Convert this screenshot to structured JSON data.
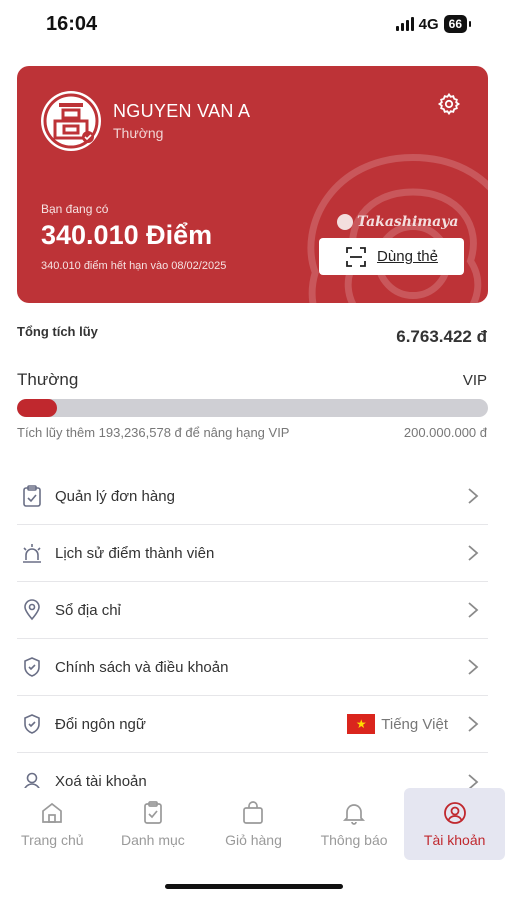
{
  "status_bar": {
    "time": "16:04",
    "network": "4G",
    "battery": "66"
  },
  "card": {
    "user_name": "NGUYEN VAN A",
    "tier": "Thường",
    "points_label": "Bạn đang có",
    "points_value": "340.010 Điểm",
    "points_expiry": "340.010 điểm hết hạn vào 08/02/2025",
    "brand": "Takashimaya",
    "use_card_label": "Dùng thẻ",
    "icons": {
      "avatar": "takashimaya-logo-icon",
      "settings": "gear-icon",
      "scan": "scan-frame-icon"
    },
    "color": "#bd3337"
  },
  "summary": {
    "total_label": "Tổng tích lũy",
    "total_value": "6.763.422 đ",
    "tier_current": "Thường",
    "tier_next": "VIP",
    "progress_fraction": 0.085,
    "progress_note": "Tích lũy thêm 193,236,578 đ để nâng hạng VIP",
    "progress_target": "200.000.000 đ",
    "accent_color": "#c0282e"
  },
  "menu": [
    {
      "label": "Quản lý đơn hàng",
      "icon": "clipboard-check-icon"
    },
    {
      "label": "Lịch sử điểm thành viên",
      "icon": "siren-icon"
    },
    {
      "label": "Sổ địa chỉ",
      "icon": "location-pin-icon"
    },
    {
      "label": "Chính sách và điều khoản",
      "icon": "shield-check-icon"
    },
    {
      "label": "Đổi ngôn ngữ",
      "icon": "shield-check-icon",
      "value": "Tiếng Việt",
      "value_icon": "vietnam-flag-icon"
    },
    {
      "label": "Xoá tài khoản",
      "icon": "user-icon"
    }
  ],
  "tabbar": [
    {
      "label": "Trang chủ",
      "icon": "home-icon"
    },
    {
      "label": "Danh mục",
      "icon": "clipboard-check-icon"
    },
    {
      "label": "Giỏ hàng",
      "icon": "shopping-bag-icon"
    },
    {
      "label": "Thông báo",
      "icon": "bell-icon"
    },
    {
      "label": "Tài khoản",
      "icon": "user-circle-icon",
      "active": true
    }
  ]
}
